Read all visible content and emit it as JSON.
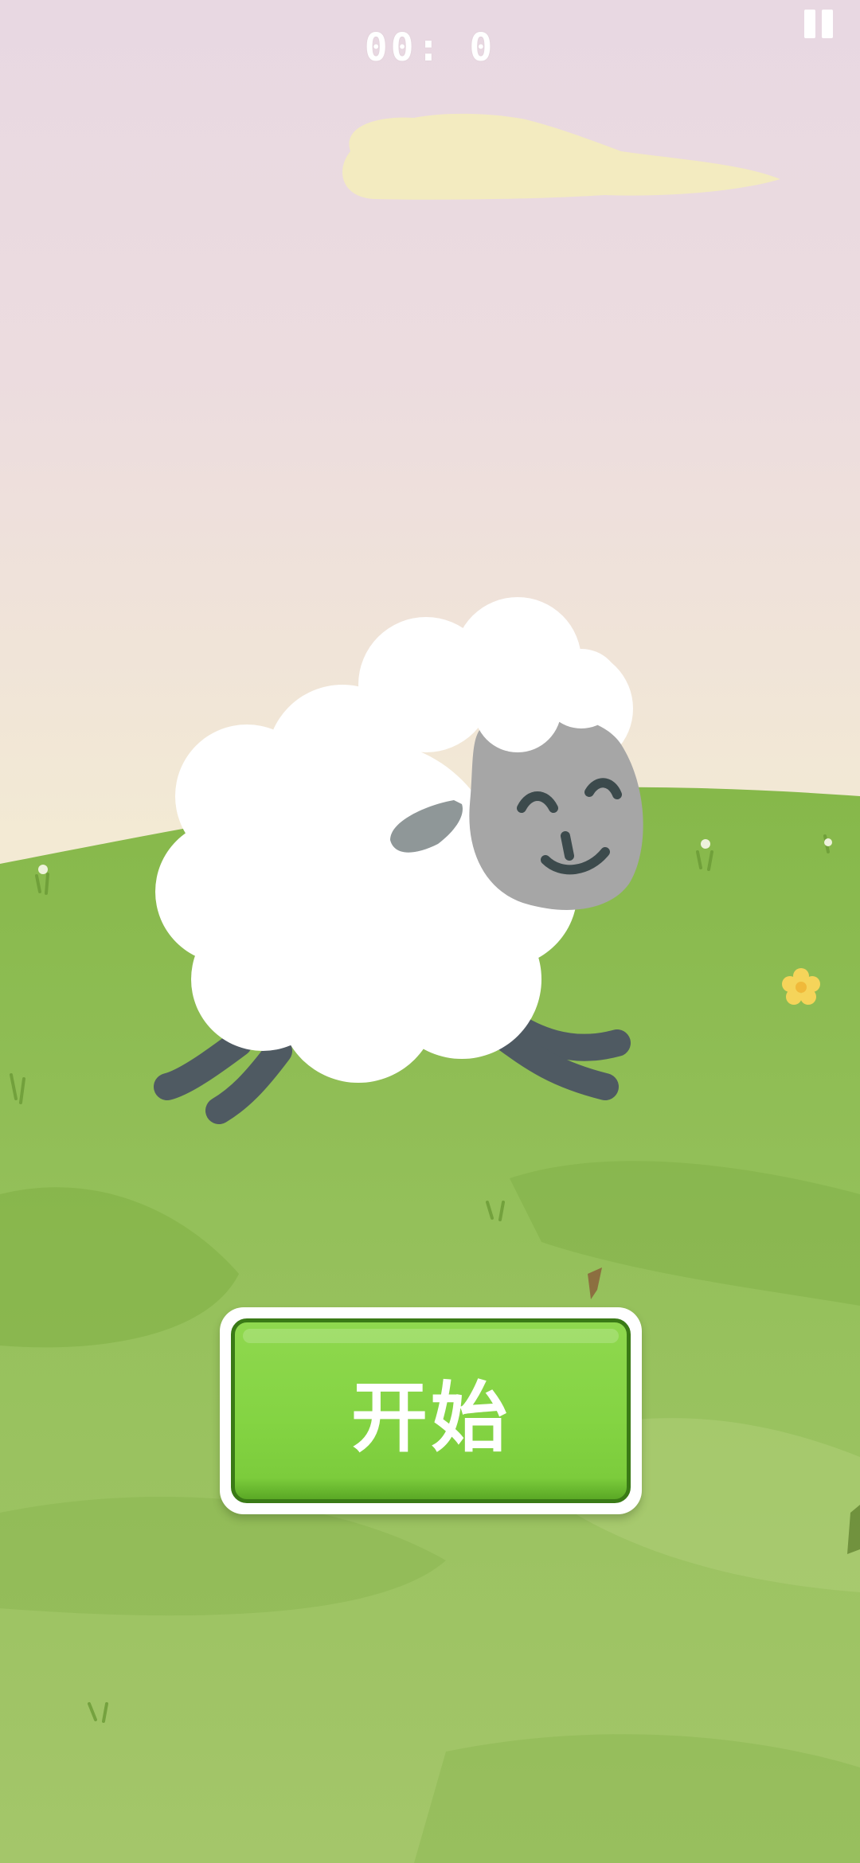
{
  "hud": {
    "timer": "00: 0",
    "pause_icon": "pause-icon"
  },
  "main": {
    "start_button_label": "开始",
    "character": "sheep"
  },
  "colors": {
    "sky_top": "#e8d8e2",
    "sky_bottom": "#f3eed6",
    "grass": "#8dbb52",
    "button_green": "#84d443",
    "button_border": "#3a7a16",
    "sheep_wool": "#ffffff",
    "sheep_face": "#a6a6a6",
    "sheep_legs": "#4f5a62"
  }
}
